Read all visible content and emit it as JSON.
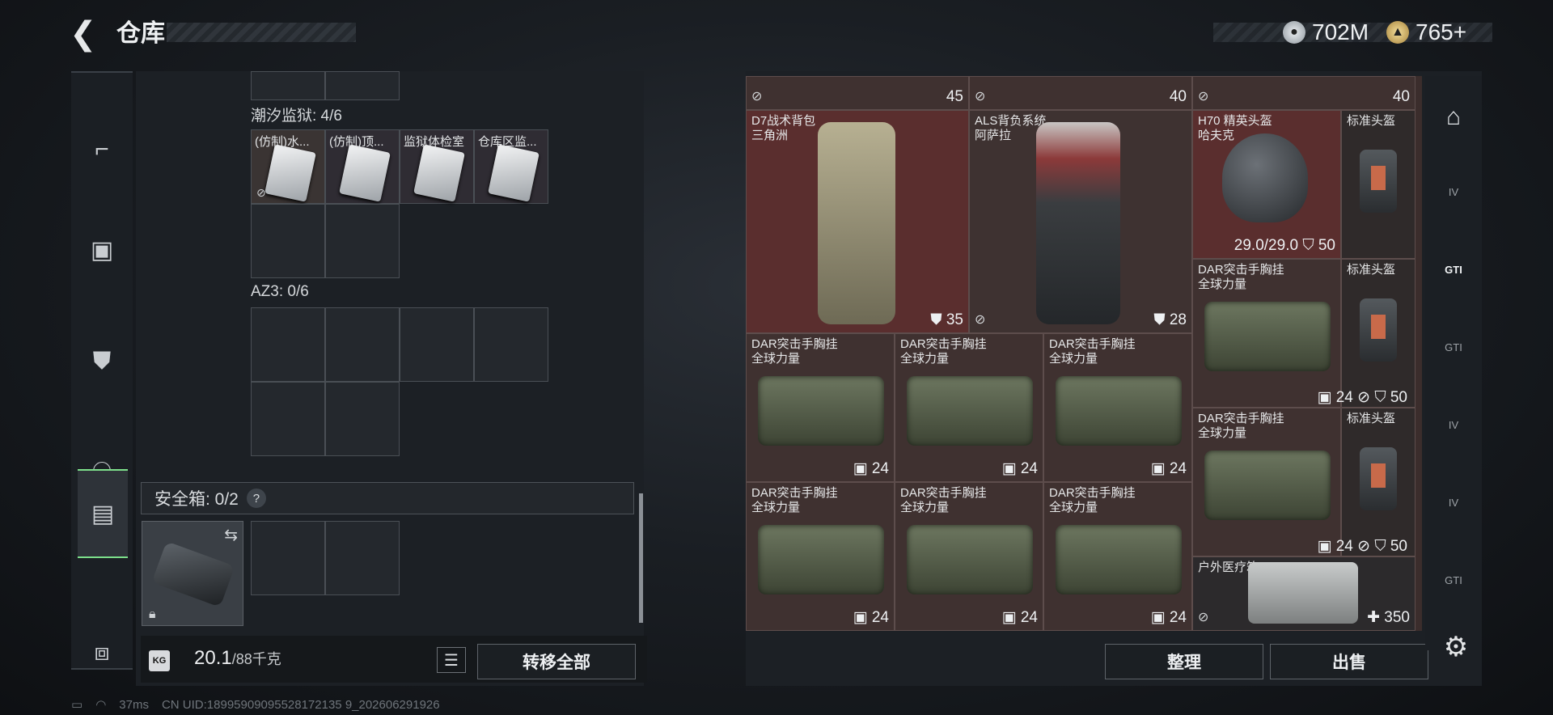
{
  "header": {
    "title": "仓库"
  },
  "currency": [
    {
      "icon": "silver-coin-icon",
      "value": "702M"
    },
    {
      "icon": "gold-coin-icon",
      "value": "765+"
    }
  ],
  "left_rail": [
    {
      "icon": "pistol-icon"
    },
    {
      "icon": "armor-vest-icon"
    },
    {
      "icon": "backpack-icon"
    },
    {
      "icon": "bag-icon"
    },
    {
      "icon": "case-icon",
      "active": true
    },
    {
      "icon": "toolbox-icon"
    }
  ],
  "containers": {
    "chaoxi": {
      "label": "潮汐监狱: 4/6",
      "items": [
        "(仿制)水...",
        "(仿制)顶...",
        "监狱体检室",
        "仓库区监..."
      ]
    },
    "az3": {
      "label": "AZ3: 0/6"
    },
    "safe": {
      "label": "安全箱: 0/2",
      "help": "?"
    }
  },
  "weight": {
    "value": "20.1",
    "limit": "/88千克"
  },
  "buttons": {
    "transfer_all": "转移全部",
    "organize": "整理",
    "sell": "出售"
  },
  "stash": {
    "top_counts": [
      "45",
      "40",
      "40"
    ],
    "items": [
      {
        "name": "D7战术背包",
        "sub": "三角洲",
        "count": "35"
      },
      {
        "name": "ALS背负系统",
        "sub": "阿萨拉",
        "count": "28"
      },
      {
        "name": "H70 精英头盔",
        "sub": "哈夫克",
        "durability": "29.0/29.0",
        "armor": "50"
      },
      {
        "name": "标准头盔",
        "sub": ""
      },
      {
        "name": "DAR突击手胸挂",
        "sub": "全球力量",
        "count": "24",
        "armor": "50"
      },
      {
        "name": "标准头盔",
        "sub": ""
      },
      {
        "name": "DAR突击手胸挂",
        "sub": "全球力量",
        "count": "24"
      },
      {
        "name": "DAR突击手胸挂",
        "sub": "全球力量",
        "count": "24"
      },
      {
        "name": "DAR突击手胸挂",
        "sub": "全球力量",
        "count": "24"
      },
      {
        "name": "DAR突击手胸挂",
        "sub": "全球力量",
        "count": "24",
        "armor": "50"
      },
      {
        "name": "标准头盔",
        "sub": ""
      },
      {
        "name": "DAR突击手胸挂",
        "sub": "全球力量",
        "count": "24"
      },
      {
        "name": "DAR突击手胸挂",
        "sub": "全球力量",
        "count": "24"
      },
      {
        "name": "DAR突击手胸挂",
        "sub": "全球力量",
        "count": "24"
      },
      {
        "name": "户外医疗箱",
        "sub": "",
        "count": "350"
      }
    ]
  },
  "right_rail": [
    "home",
    "IV",
    "GTI",
    "GTI",
    "IV",
    "IV",
    "GTI"
  ],
  "footer": {
    "ping": "37ms",
    "uid": "CN UID:18995909095528172135 9_202606291926"
  }
}
